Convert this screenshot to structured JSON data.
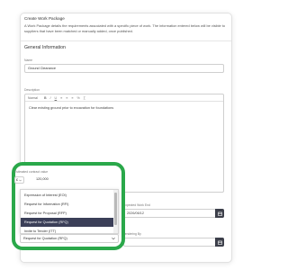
{
  "card": {
    "title": "Create Work Package",
    "description": "A Work Package details the requirements associated with a specific piece of work. The information entered below will be visible to suppliers that have been matched or manually added, once published."
  },
  "general": {
    "section_title": "General Information",
    "name_label": "Name",
    "name_value": "Ground Clearance",
    "description_label": "Description",
    "editor_text": "Clear existing ground prior to excavation for foundations",
    "toolbar": {
      "format_label": "Normal",
      "buttons": [
        "B",
        "I",
        "U",
        "≡",
        "≡",
        "≡",
        "%",
        "T̲"
      ]
    }
  },
  "estimate": {
    "label": "Estimated contract value",
    "currency": "£",
    "amount": "120,000"
  },
  "dates": {
    "end_label": "Expected Work End",
    "end_value": "2026/06/12",
    "other_label": "Tendering By"
  },
  "tender_type": {
    "options": [
      "Expression of Interest (EOI)",
      "Request for Information (RFI)",
      "Request for Proposal (RFP)",
      "Request for Quotation (RFQ)",
      "Invite to Tender (ITT)"
    ],
    "selected": "Request for Quotation (RFQ)"
  },
  "colors": {
    "highlight": "#2aa84a",
    "selected_option": "#3b3f58",
    "calendar_button": "#3c3f4a"
  }
}
